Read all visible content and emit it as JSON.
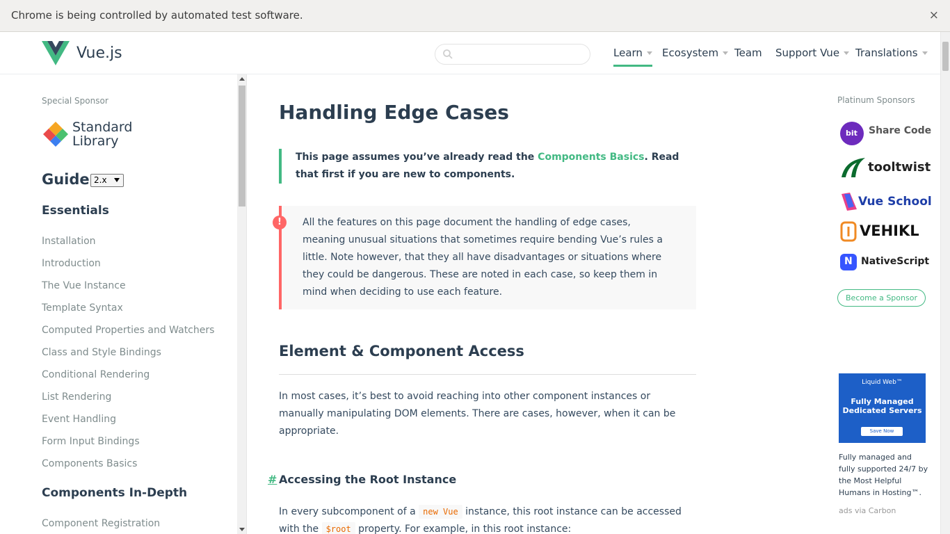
{
  "infobar": {
    "message": "Chrome is being controlled by automated test software.",
    "close": "×"
  },
  "header": {
    "brand": "Vue.js",
    "search": {
      "value": "",
      "placeholder": ""
    },
    "nav": [
      {
        "label": "Learn",
        "dropdown": true,
        "active": true
      },
      {
        "label": "Ecosystem",
        "dropdown": true
      },
      {
        "label": "Team",
        "dropdown": false
      },
      {
        "label": "Support Vue",
        "dropdown": true
      },
      {
        "label": "Translations",
        "dropdown": true
      }
    ]
  },
  "sidebar": {
    "special_sponsor_label": "Special Sponsor",
    "sponsor_name_line1": "Standard",
    "sponsor_name_line2": "Library",
    "guide_title": "Guide",
    "version": "2.x",
    "sections": [
      {
        "heading": "Essentials",
        "items": [
          "Installation",
          "Introduction",
          "The Vue Instance",
          "Template Syntax",
          "Computed Properties and Watchers",
          "Class and Style Bindings",
          "Conditional Rendering",
          "List Rendering",
          "Event Handling",
          "Form Input Bindings",
          "Components Basics"
        ]
      },
      {
        "heading": "Components In-Depth",
        "items": [
          "Component Registration"
        ]
      }
    ]
  },
  "content": {
    "title": "Handling Edge Cases",
    "tip": {
      "before": "This page assumes you’ve already read the ",
      "link": "Components Basics",
      "after": ". Read that first if you are new to components."
    },
    "warning": "All the features on this page document the handling of edge cases, meaning unusual situations that sometimes require bending Vue’s rules a little. Note however, that they all have disadvantages or situations where they could be dangerous. These are noted in each case, so keep them in mind when deciding to use each feature.",
    "warning_icon": "!",
    "section_title": "Element & Component Access",
    "section_para": "In most cases, it’s best to avoid reaching into other component instances or manually manipulating DOM elements. There are cases, however, when it can be appropriate.",
    "subsection_hash": "#",
    "subsection_title": "Accessing the Root Instance",
    "sub_para": {
      "t1": "In every subcomponent of a ",
      "code1": "new Vue",
      "t2": " instance, this root instance can be accessed with the ",
      "code2": "$root",
      "t3": " property. For example, in this root instance:"
    }
  },
  "right": {
    "platinum_label": "Platinum Sponsors",
    "sponsors": [
      {
        "name": "Share Code",
        "icon_text": "bit",
        "color": "#6d2bbd"
      },
      {
        "name": "tooltwist",
        "color": "#0b6b2e"
      },
      {
        "name": "Vue School",
        "color": "#1e3ea8"
      },
      {
        "name": "VEHIKL",
        "color": "#1a1a1a"
      },
      {
        "name": "NativeScript",
        "icon_text": "N",
        "color": "#3655ff"
      }
    ],
    "become_sponsor": "Become a Sponsor",
    "ad": {
      "brand": "Liquid Web™",
      "headline_line1": "Fully Managed",
      "headline_line2": "Dedicated Servers",
      "cta": "Save Now",
      "description": "Fully managed and fully supported 24/7 by the Most Helpful Humans in Hosting™.",
      "via": "ads via Carbon"
    }
  },
  "colors": {
    "accent": "#42b983",
    "danger": "#ff6666",
    "text": "#2c3e50"
  }
}
